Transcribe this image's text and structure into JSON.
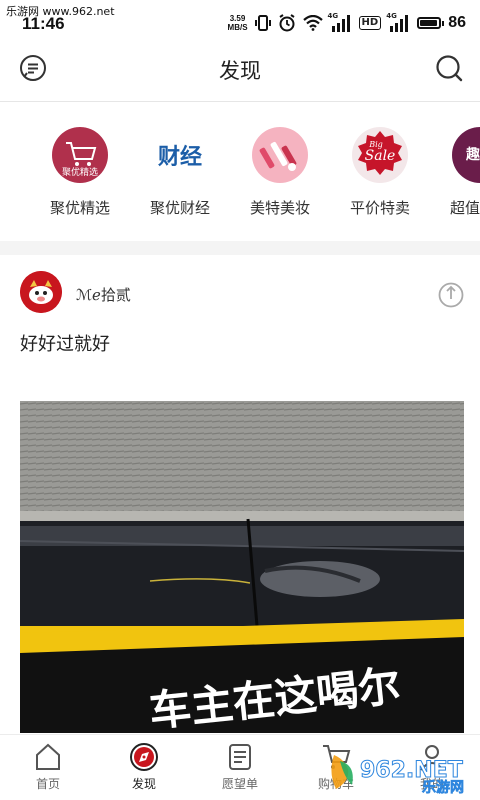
{
  "status_bar": {
    "site": "乐游网 www.962.net",
    "time": "11:46",
    "speed_top": "3.59",
    "speed_unit": "MB/S",
    "net1": "4G",
    "net1_sub": "HD",
    "net2": "4G",
    "battery": "86"
  },
  "header": {
    "title": "发现",
    "msg_icon": "message-icon",
    "search_icon": "search-icon"
  },
  "categories": [
    {
      "label": "聚优精选",
      "icon": "shopping-cart-icon",
      "icon_text": "聚优精选",
      "color": "#b0304c"
    },
    {
      "label": "聚优财经",
      "icon": "finance-icon",
      "icon_text": "财经",
      "color": "#1c5ea8"
    },
    {
      "label": "美特美妆",
      "icon": "makeup-icon",
      "icon_text": "",
      "color": "#f2a7b6"
    },
    {
      "label": "平价特卖",
      "icon": "sale-icon",
      "icon_text": "Sale",
      "icon_sup": "Big",
      "color": "#c6152a"
    },
    {
      "label": "超值",
      "icon": "deal-icon",
      "icon_text": "趣团",
      "color": "#6a1d4a"
    }
  ],
  "post": {
    "author": "ℳℯ拾贰",
    "text": "好好过就好",
    "share_icon": "share-icon",
    "image": {
      "desc_icon": "photo",
      "sign_text": "车主在这喝尔"
    }
  },
  "bottom_nav": [
    {
      "label": "首页",
      "icon": "home-icon",
      "active": false
    },
    {
      "label": "发现",
      "icon": "discover-icon",
      "active": true
    },
    {
      "label": "愿望单",
      "icon": "wishlist-icon",
      "active": false
    },
    {
      "label": "购物车",
      "icon": "cart-icon",
      "active": false
    },
    {
      "label": "我的",
      "icon": "profile-icon",
      "active": false
    }
  ],
  "watermark": {
    "text": "962.NET",
    "sub": "乐游网"
  },
  "colors": {
    "accent": "#c8161e",
    "divider": "#e6e6e6",
    "gap": "#f4f4f4"
  }
}
